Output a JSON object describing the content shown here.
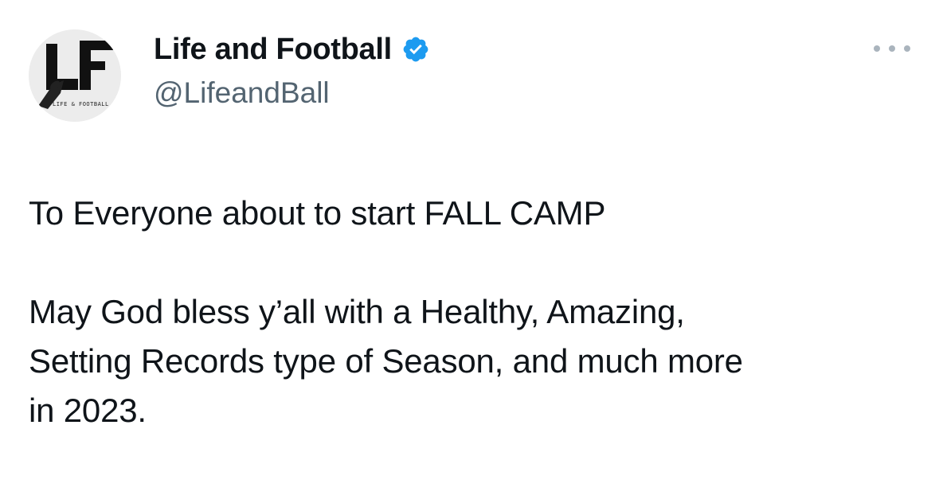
{
  "author": {
    "display_name": "Life and Football",
    "handle": "@LifeandBall",
    "verified": true,
    "verified_color": "#1d9bf0",
    "avatar_logo": "LF",
    "avatar_tagline": "LIFE & FOOTBALL"
  },
  "more_menu": {
    "icon": "more-horizontal-icon"
  },
  "tweet": {
    "paragraph_1": "To Everyone about to start FALL CAMP",
    "paragraph_2": "May God bless y’all with a Healthy, Amazing,\nSetting Records type of Season, and much more\nin 2023."
  }
}
